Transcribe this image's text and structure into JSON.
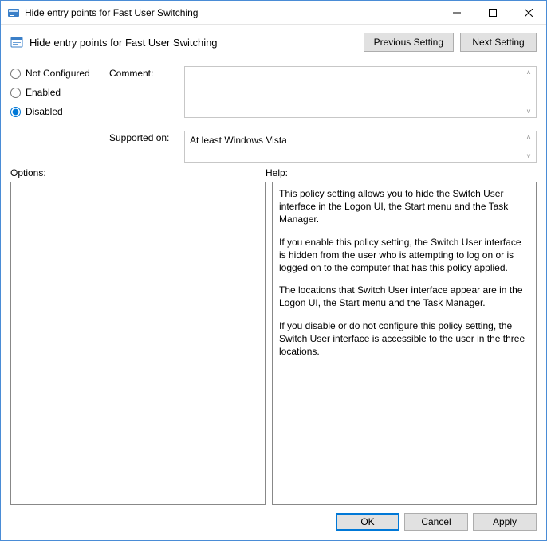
{
  "window": {
    "title": "Hide entry points for Fast User Switching",
    "header_title": "Hide entry points for Fast User Switching"
  },
  "nav": {
    "prev": "Previous Setting",
    "next": "Next Setting"
  },
  "state": {
    "not_configured_label": "Not Configured",
    "enabled_label": "Enabled",
    "disabled_label": "Disabled",
    "selected": "disabled"
  },
  "labels": {
    "comment": "Comment:",
    "supported_on": "Supported on:",
    "options": "Options:",
    "help": "Help:"
  },
  "fields": {
    "comment_value": "",
    "supported_on_value": "At least Windows Vista"
  },
  "help": {
    "p1": "This policy setting allows you to hide the Switch User interface in the Logon UI, the Start menu and the Task Manager.",
    "p2": "If you enable this policy setting, the Switch User interface is hidden from the user who is attempting to log on or is logged on to the computer that has this policy applied.",
    "p3": "The locations that Switch User interface appear are in the Logon UI, the Start menu and the Task Manager.",
    "p4": "If you disable or do not configure this policy setting, the Switch User interface is accessible to the user in the three locations."
  },
  "buttons": {
    "ok": "OK",
    "cancel": "Cancel",
    "apply": "Apply"
  }
}
